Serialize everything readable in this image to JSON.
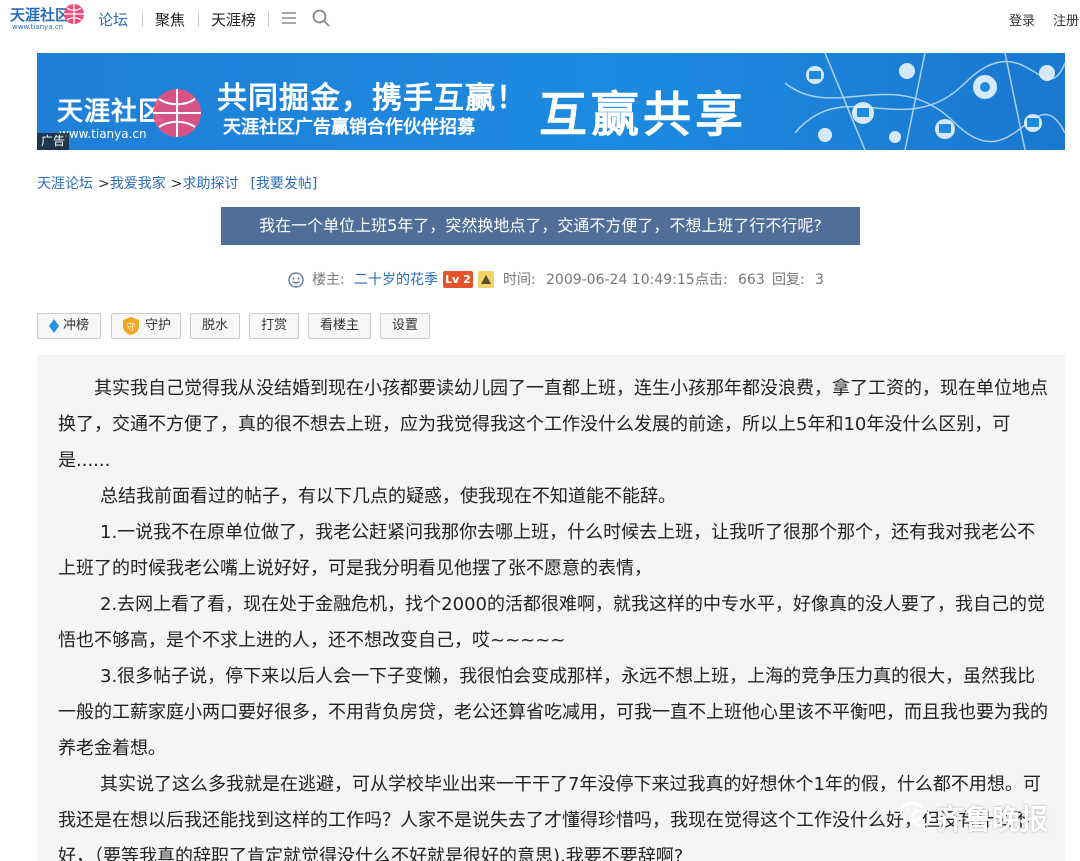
{
  "nav": {
    "logo_text": "天涯社区",
    "logo_url": "www.tianya.cn",
    "forum": "论坛",
    "focus": "聚焦",
    "rank": "天涯榜",
    "login": "登录",
    "register": "注册"
  },
  "banner": {
    "logo_text": "天涯社区",
    "logo_url": "www.tianya.cn",
    "slogan": "共同掘金，携手互赢！",
    "subtitle": "天涯社区广告赢销合作伙伴招募",
    "big_text": "互赢共享",
    "ad_tag": "广告"
  },
  "breadcrumb": {
    "items": [
      "天涯论坛",
      "我爱我家",
      "求助探讨"
    ],
    "separator": ">",
    "post_link": "[我要发帖]"
  },
  "post": {
    "title": "我在一个单位上班5年了，突然换地点了，交通不方便了，不想上班了行不行呢?",
    "author_label": "楼主:",
    "author": "二十岁的花季",
    "level": "Lv 2",
    "time_label": "时间:",
    "time": "2009-06-24 10:49:15",
    "clicks_label": "点击:",
    "clicks": "663",
    "replies_label": "回复:",
    "replies": "3",
    "paragraphs": [
      "其实我自己觉得我从没结婚到现在小孩都要读幼儿园了一直都上班，连生小孩那年都没浪费，拿了工资的，现在单位地点换了，交通不方便了，真的很不想去上班，应为我觉得我这个工作没什么发展的前途，所以上5年和10年没什么区别，可是......",
      "总结我前面看过的帖子，有以下几点的疑惑，使我现在不知道能不能辞。",
      "1.一说我不在原单位做了，我老公赶紧问我那你去哪上班，什么时候去上班，让我听了很那个那个，还有我对我老公不上班了的时候我老公嘴上说好好，可是我分明看见他摆了张不愿意的表情，",
      "2.去网上看了看，现在处于金融危机，找个2000的活都很难啊，就我这样的中专水平，好像真的没人要了，我自己的觉悟也不够高，是个不求上进的人，还不想改变自己，哎~~~~~",
      "3.很多帖子说，停下来以后人会一下子变懒，我很怕会变成那样，永远不想上班，上海的竞争压力真的很大，虽然我比一般的工薪家庭小两口要好很多，不用背负房贷，老公还算省吃减用，可我一直不上班他心里该不平衡吧，而且我也要为我的养老金着想。",
      "其实说了这么多我就是在逃避，可从学校毕业出来一干干了7年没停下来过我真的好想休个1年的假，什么都不用想。可我还是在想以后我还能找到这样的工作吗？人家不是说失去了才懂得珍惜吗，我现在觉得这个工作没什么好，但没有什么不好，（要等我真的辞职了肯定就觉得没什么不好就是很好的意思),我要不要辞啊?"
    ]
  },
  "actions": {
    "rank": "冲榜",
    "guard": "守护",
    "dehydrate": "脱水",
    "reward": "打赏",
    "author_only": "看楼主",
    "settings": "设置"
  },
  "watermark": "齐鲁晚报"
}
